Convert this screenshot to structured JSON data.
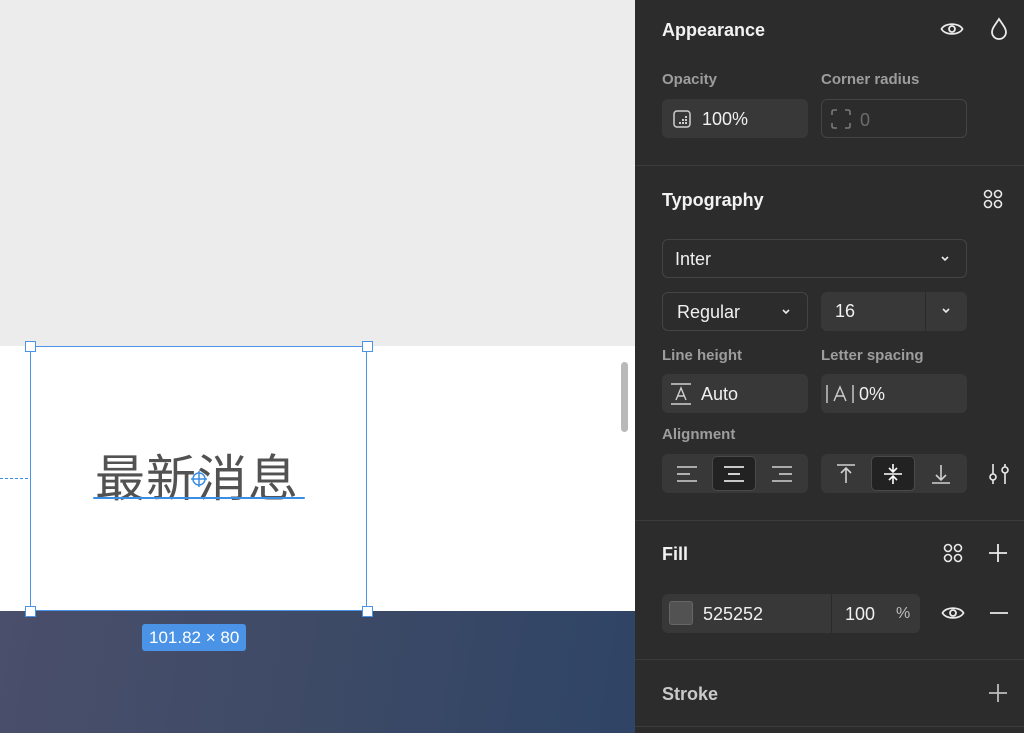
{
  "canvas": {
    "selected_text": "最新消息",
    "dimensions_label": "101.82 × 80"
  },
  "appearance": {
    "title": "Appearance",
    "opacity_label": "Opacity",
    "opacity_value": "100%",
    "corner_radius_label": "Corner radius",
    "corner_radius_value": "0"
  },
  "typography": {
    "title": "Typography",
    "font_family": "Inter",
    "font_weight": "Regular",
    "font_size": "16",
    "line_height_label": "Line height",
    "line_height_value": "Auto",
    "letter_spacing_label": "Letter spacing",
    "letter_spacing_value": "0%",
    "alignment_label": "Alignment",
    "horizontal_align_selected": "center",
    "vertical_align_selected": "middle"
  },
  "fill": {
    "title": "Fill",
    "hex": "525252",
    "opacity": "100",
    "opacity_unit": "%",
    "color": "#525252"
  },
  "stroke": {
    "title": "Stroke"
  },
  "colors": {
    "selection": "#4b93e6",
    "panel_bg": "#2c2c2c",
    "field_bg": "#383838"
  }
}
